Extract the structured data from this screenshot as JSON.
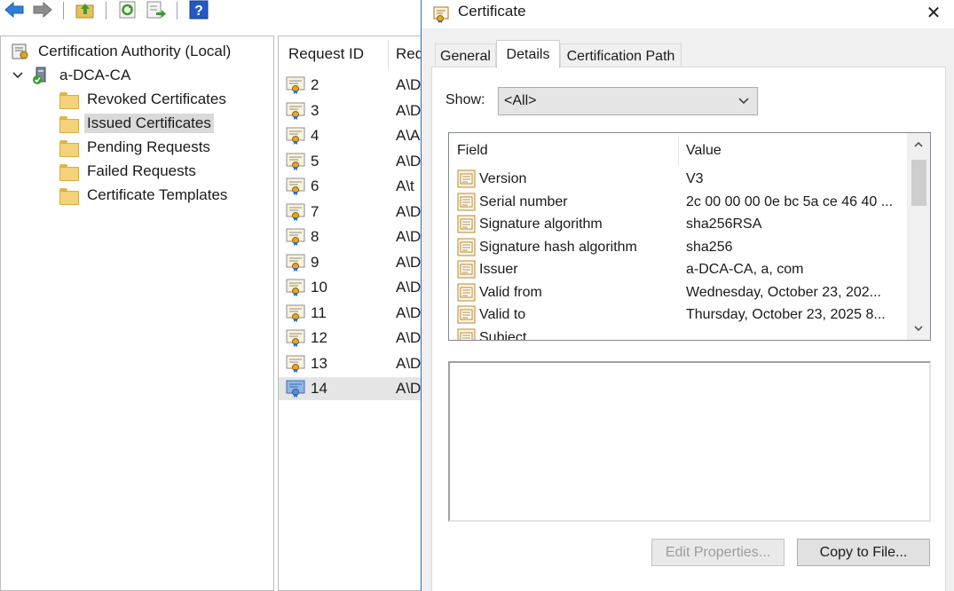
{
  "tree": {
    "root_label": "Certification Authority (Local)",
    "ca_label": "a-DCA-CA",
    "folders": [
      {
        "label": "Revoked Certificates"
      },
      {
        "label": "Issued Certificates"
      },
      {
        "label": "Pending Requests"
      },
      {
        "label": "Failed Requests"
      },
      {
        "label": "Certificate Templates"
      }
    ]
  },
  "list": {
    "columns": [
      "Request ID",
      "Req"
    ],
    "rows": [
      {
        "id": "2",
        "req": "A\\D"
      },
      {
        "id": "3",
        "req": "A\\D"
      },
      {
        "id": "4",
        "req": "A\\A"
      },
      {
        "id": "5",
        "req": "A\\D"
      },
      {
        "id": "6",
        "req": "A\\t"
      },
      {
        "id": "7",
        "req": "A\\D"
      },
      {
        "id": "8",
        "req": "A\\D"
      },
      {
        "id": "9",
        "req": "A\\D"
      },
      {
        "id": "10",
        "req": "A\\D"
      },
      {
        "id": "11",
        "req": "A\\D"
      },
      {
        "id": "12",
        "req": "A\\D"
      },
      {
        "id": "13",
        "req": "A\\D"
      },
      {
        "id": "14",
        "req": "A\\D"
      }
    ]
  },
  "dialog": {
    "title": "Certificate",
    "close_glyph": "✕",
    "tabs": [
      "General",
      "Details",
      "Certification Path"
    ],
    "show_label": "Show:",
    "show_value": "<All>",
    "field_header": "Field",
    "value_header": "Value",
    "fields": [
      {
        "name": "Version",
        "value": "V3"
      },
      {
        "name": "Serial number",
        "value": "2c 00 00 00 0e bc 5a ce 46 40 ..."
      },
      {
        "name": "Signature algorithm",
        "value": "sha256RSA"
      },
      {
        "name": "Signature hash algorithm",
        "value": "sha256"
      },
      {
        "name": "Issuer",
        "value": "a-DCA-CA, a, com"
      },
      {
        "name": "Valid from",
        "value": "Wednesday, October 23, 202..."
      },
      {
        "name": "Valid to",
        "value": "Thursday, October 23, 2025 8..."
      },
      {
        "name": "Subject",
        "value": ""
      }
    ],
    "edit_properties_label": "Edit Properties...",
    "copy_to_file_label": "Copy to File..."
  }
}
